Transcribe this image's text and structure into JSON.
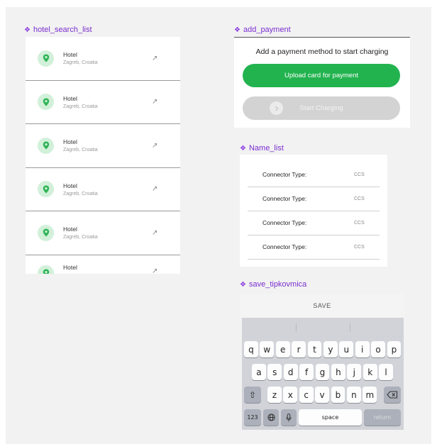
{
  "frames": {
    "hotel_list_label": "hotel_search_list",
    "add_payment_label": "add_payment",
    "name_list_label": "Name_list",
    "keyboard_label": "save_tipkovmica"
  },
  "hotels": [
    {
      "name": "Hotel",
      "location": "Zagreb, Croatia"
    },
    {
      "name": "Hotel",
      "location": "Zagreb, Croatia"
    },
    {
      "name": "Hotel",
      "location": "Zagreb, Croatia"
    },
    {
      "name": "Hotel",
      "location": "Zagreb, Croatia"
    },
    {
      "name": "Hotel",
      "location": "Zagreb, Croatia"
    },
    {
      "name": "Hotel",
      "location": ""
    }
  ],
  "payment": {
    "title": "Add a payment method to start charging",
    "upload_label": "Upload card for payment",
    "charge_label": "Start Charging"
  },
  "connectors": [
    {
      "label": "Connector Type:",
      "value": "CCS"
    },
    {
      "label": "Connector Type:",
      "value": "CCS"
    },
    {
      "label": "Connector Type:",
      "value": "CCS"
    },
    {
      "label": "Connector Type:",
      "value": "CCS"
    }
  ],
  "keyboard": {
    "save_label": "SAVE",
    "row1": [
      "q",
      "w",
      "e",
      "r",
      "t",
      "y",
      "u",
      "i",
      "o",
      "p"
    ],
    "row2": [
      "a",
      "s",
      "d",
      "f",
      "g",
      "h",
      "j",
      "k",
      "l"
    ],
    "row3": [
      "z",
      "x",
      "c",
      "v",
      "b",
      "n",
      "m"
    ],
    "num_label": "123",
    "space_label": "space",
    "return_label": "return"
  },
  "colors": {
    "accent_purple": "#7b2fd0",
    "primary_green": "#22b34f",
    "pin_bg": "#d2f0da",
    "disabled_gray": "#d3d3d3"
  },
  "icons": {
    "frame": "component-diamond-icon",
    "hotel": "map-pin-icon",
    "hotel_action": "arrow-up-right-icon",
    "charge": "chevron-right-icon",
    "shift": "shift-icon",
    "delete": "backspace-icon",
    "globe": "globe-icon",
    "mic": "microphone-icon"
  }
}
